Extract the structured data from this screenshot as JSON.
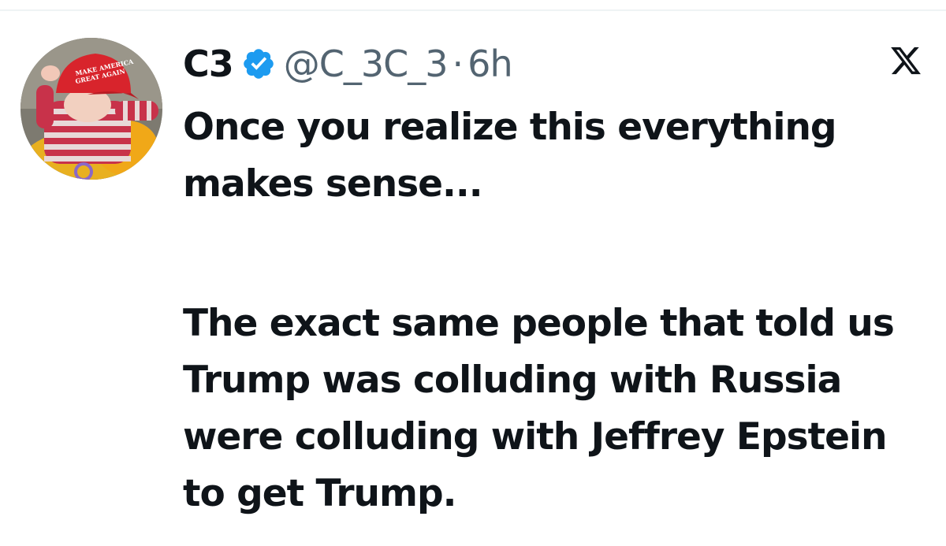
{
  "tweet": {
    "author": {
      "display_name": "C3",
      "handle": "@C_3C_3",
      "verified": true,
      "avatar_hat_text": "MAKE AMERICA GREAT AGAIN"
    },
    "separator": "·",
    "timestamp": "6h",
    "platform_logo": "x-logo",
    "text_paragraph_1": "Once you realize this everything makes sense...",
    "text_paragraph_2": "The exact same people that told us Trump was colluding with Russia were colluding with Jeffrey Epstein to get Trump."
  },
  "colors": {
    "text_primary": "#0f1419",
    "text_secondary": "#536471",
    "verified_blue": "#1d9bf0",
    "background": "#ffffff"
  },
  "icons": {
    "verified": "verified-badge-icon",
    "logo": "x-logo-icon"
  }
}
